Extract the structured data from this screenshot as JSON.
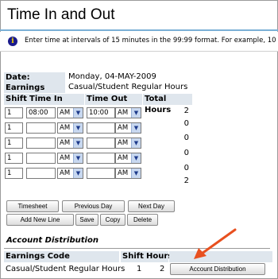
{
  "page": {
    "title": "Time In and Out",
    "info_text": "Enter time at intervals of 15 minutes in the 99:99 format. For example, 10"
  },
  "details": {
    "date_label": "Date:",
    "date_value": "Monday, 04-MAY-2009",
    "earnings_label": "Earnings Code:",
    "earnings_value": "Casual/Student Regular Hours"
  },
  "table": {
    "headers": {
      "shift": "Shift",
      "time_in": "Time In",
      "time_out": "Time Out",
      "total_hours": "Total Hours"
    },
    "first_row_total": "2",
    "rows": [
      {
        "shift": "1",
        "time_in": "08:00",
        "am_in": "AM",
        "time_out": "10:00",
        "am_out": "AM",
        "total": "0"
      },
      {
        "shift": "1",
        "time_in": "",
        "am_in": "AM",
        "time_out": "",
        "am_out": "AM",
        "total": "0"
      },
      {
        "shift": "1",
        "time_in": "",
        "am_in": "AM",
        "time_out": "",
        "am_out": "AM",
        "total": "0"
      },
      {
        "shift": "1",
        "time_in": "",
        "am_in": "AM",
        "time_out": "",
        "am_out": "AM",
        "total": "0"
      },
      {
        "shift": "1",
        "time_in": "",
        "am_in": "AM",
        "time_out": "",
        "am_out": "AM",
        "total": "0"
      }
    ],
    "grand_total": "2"
  },
  "buttons": {
    "timesheet": "Timesheet",
    "previous_day": "Previous Day",
    "next_day": "Next Day",
    "add_new_line": "Add New Line",
    "save": "Save",
    "copy": "Copy",
    "delete": "Delete"
  },
  "account": {
    "section_title": "Account Distribution",
    "headers": {
      "earnings_code": "Earnings Code",
      "shift": "Shift",
      "hours": "Hours"
    },
    "row": {
      "earnings_code": "Casual/Student Regular Hours",
      "shift": "1",
      "hours": "2"
    },
    "button": "Account Distribution"
  },
  "colors": {
    "accent_rule": "#7bb0d6",
    "label_bg": "#dfe6ed",
    "arrow": "#e8501f"
  }
}
